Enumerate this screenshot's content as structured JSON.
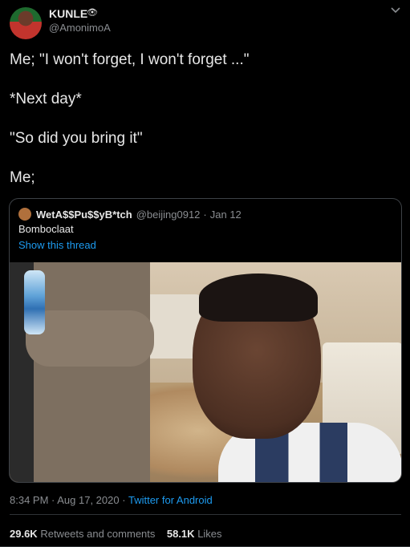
{
  "author": {
    "name": "KUNLE",
    "badge_icon": "eye-icon",
    "handle": "@AmonimoA"
  },
  "tweet_lines": [
    "Me; \"I won't forget, I won't forget ...\"",
    "*Next day*",
    "\"So did you bring it\"",
    "Me;"
  ],
  "quoted": {
    "name": "WetA$$Pu$$yB*tch",
    "handle": "@beijing0912",
    "date": "Jan 12",
    "text": "Bomboclaat",
    "show_thread": "Show this thread"
  },
  "meta": {
    "time_date": "8:34 PM · Aug 17, 2020",
    "dot": "·",
    "source": "Twitter for Android"
  },
  "stats": {
    "retweets_count": "29.6K",
    "retweets_label": "Retweets and comments",
    "likes_count": "58.1K",
    "likes_label": "Likes"
  },
  "colors": {
    "link": "#1d9bf0",
    "background": "#000000",
    "muted": "#8a8d91"
  }
}
